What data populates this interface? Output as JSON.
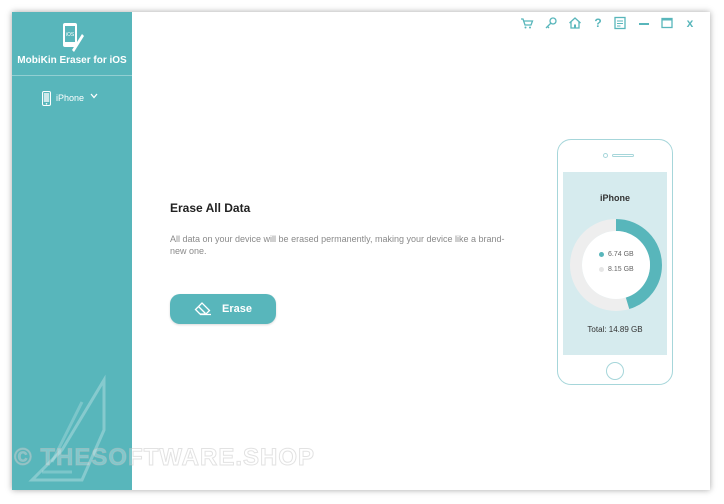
{
  "app": {
    "title": "MobiKin Eraser for iOS",
    "logo_text": "iOS"
  },
  "sidebar": {
    "device_label": "iPhone"
  },
  "toolbar": {
    "icons": [
      "cart-icon",
      "key-icon",
      "home-icon",
      "help-icon",
      "feedback-icon",
      "minimize-icon",
      "maximize-icon",
      "close-icon"
    ],
    "help_glyph": "?",
    "close_glyph": "x"
  },
  "main": {
    "title": "Erase All Data",
    "description": "All data on your device will be erased permanently, making your device like a brand-new one.",
    "erase_button_label": "Erase"
  },
  "device": {
    "name": "iPhone",
    "used": "6.74 GB",
    "free": "8.15 GB",
    "total": "Total:  14.89 GB",
    "used_fraction": 0.4526
  },
  "watermark": {
    "text": "© THESOFTWARE.SHOP"
  },
  "colors": {
    "accent": "#58b6bb",
    "used_ring": "#58b6bb",
    "free_ring": "#eeeeee",
    "screen_bg": "#d6ebee"
  }
}
